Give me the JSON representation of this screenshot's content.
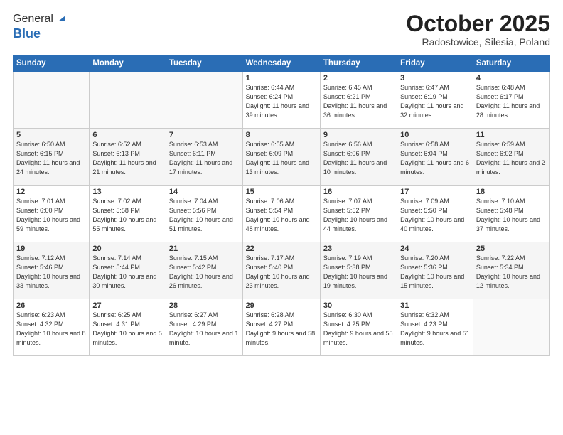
{
  "header": {
    "logo_general": "General",
    "logo_blue": "Blue",
    "month_title": "October 2025",
    "location": "Radostowice, Silesia, Poland"
  },
  "weekdays": [
    "Sunday",
    "Monday",
    "Tuesday",
    "Wednesday",
    "Thursday",
    "Friday",
    "Saturday"
  ],
  "weeks": [
    [
      {
        "day": "",
        "info": ""
      },
      {
        "day": "",
        "info": ""
      },
      {
        "day": "",
        "info": ""
      },
      {
        "day": "1",
        "info": "Sunrise: 6:44 AM\nSunset: 6:24 PM\nDaylight: 11 hours\nand 39 minutes."
      },
      {
        "day": "2",
        "info": "Sunrise: 6:45 AM\nSunset: 6:21 PM\nDaylight: 11 hours\nand 36 minutes."
      },
      {
        "day": "3",
        "info": "Sunrise: 6:47 AM\nSunset: 6:19 PM\nDaylight: 11 hours\nand 32 minutes."
      },
      {
        "day": "4",
        "info": "Sunrise: 6:48 AM\nSunset: 6:17 PM\nDaylight: 11 hours\nand 28 minutes."
      }
    ],
    [
      {
        "day": "5",
        "info": "Sunrise: 6:50 AM\nSunset: 6:15 PM\nDaylight: 11 hours\nand 24 minutes."
      },
      {
        "day": "6",
        "info": "Sunrise: 6:52 AM\nSunset: 6:13 PM\nDaylight: 11 hours\nand 21 minutes."
      },
      {
        "day": "7",
        "info": "Sunrise: 6:53 AM\nSunset: 6:11 PM\nDaylight: 11 hours\nand 17 minutes."
      },
      {
        "day": "8",
        "info": "Sunrise: 6:55 AM\nSunset: 6:09 PM\nDaylight: 11 hours\nand 13 minutes."
      },
      {
        "day": "9",
        "info": "Sunrise: 6:56 AM\nSunset: 6:06 PM\nDaylight: 11 hours\nand 10 minutes."
      },
      {
        "day": "10",
        "info": "Sunrise: 6:58 AM\nSunset: 6:04 PM\nDaylight: 11 hours\nand 6 minutes."
      },
      {
        "day": "11",
        "info": "Sunrise: 6:59 AM\nSunset: 6:02 PM\nDaylight: 11 hours\nand 2 minutes."
      }
    ],
    [
      {
        "day": "12",
        "info": "Sunrise: 7:01 AM\nSunset: 6:00 PM\nDaylight: 10 hours\nand 59 minutes."
      },
      {
        "day": "13",
        "info": "Sunrise: 7:02 AM\nSunset: 5:58 PM\nDaylight: 10 hours\nand 55 minutes."
      },
      {
        "day": "14",
        "info": "Sunrise: 7:04 AM\nSunset: 5:56 PM\nDaylight: 10 hours\nand 51 minutes."
      },
      {
        "day": "15",
        "info": "Sunrise: 7:06 AM\nSunset: 5:54 PM\nDaylight: 10 hours\nand 48 minutes."
      },
      {
        "day": "16",
        "info": "Sunrise: 7:07 AM\nSunset: 5:52 PM\nDaylight: 10 hours\nand 44 minutes."
      },
      {
        "day": "17",
        "info": "Sunrise: 7:09 AM\nSunset: 5:50 PM\nDaylight: 10 hours\nand 40 minutes."
      },
      {
        "day": "18",
        "info": "Sunrise: 7:10 AM\nSunset: 5:48 PM\nDaylight: 10 hours\nand 37 minutes."
      }
    ],
    [
      {
        "day": "19",
        "info": "Sunrise: 7:12 AM\nSunset: 5:46 PM\nDaylight: 10 hours\nand 33 minutes."
      },
      {
        "day": "20",
        "info": "Sunrise: 7:14 AM\nSunset: 5:44 PM\nDaylight: 10 hours\nand 30 minutes."
      },
      {
        "day": "21",
        "info": "Sunrise: 7:15 AM\nSunset: 5:42 PM\nDaylight: 10 hours\nand 26 minutes."
      },
      {
        "day": "22",
        "info": "Sunrise: 7:17 AM\nSunset: 5:40 PM\nDaylight: 10 hours\nand 23 minutes."
      },
      {
        "day": "23",
        "info": "Sunrise: 7:19 AM\nSunset: 5:38 PM\nDaylight: 10 hours\nand 19 minutes."
      },
      {
        "day": "24",
        "info": "Sunrise: 7:20 AM\nSunset: 5:36 PM\nDaylight: 10 hours\nand 15 minutes."
      },
      {
        "day": "25",
        "info": "Sunrise: 7:22 AM\nSunset: 5:34 PM\nDaylight: 10 hours\nand 12 minutes."
      }
    ],
    [
      {
        "day": "26",
        "info": "Sunrise: 6:23 AM\nSunset: 4:32 PM\nDaylight: 10 hours\nand 8 minutes."
      },
      {
        "day": "27",
        "info": "Sunrise: 6:25 AM\nSunset: 4:31 PM\nDaylight: 10 hours\nand 5 minutes."
      },
      {
        "day": "28",
        "info": "Sunrise: 6:27 AM\nSunset: 4:29 PM\nDaylight: 10 hours\nand 1 minute."
      },
      {
        "day": "29",
        "info": "Sunrise: 6:28 AM\nSunset: 4:27 PM\nDaylight: 9 hours\nand 58 minutes."
      },
      {
        "day": "30",
        "info": "Sunrise: 6:30 AM\nSunset: 4:25 PM\nDaylight: 9 hours\nand 55 minutes."
      },
      {
        "day": "31",
        "info": "Sunrise: 6:32 AM\nSunset: 4:23 PM\nDaylight: 9 hours\nand 51 minutes."
      },
      {
        "day": "",
        "info": ""
      }
    ]
  ]
}
